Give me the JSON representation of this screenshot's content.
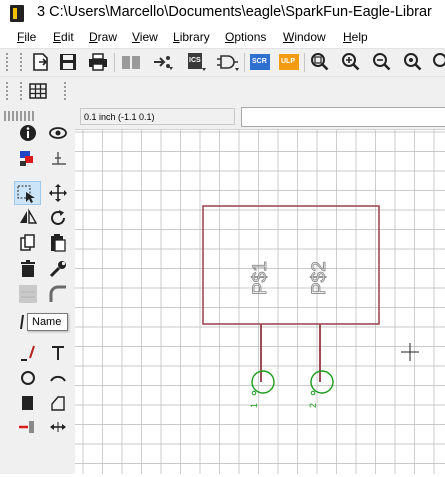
{
  "window": {
    "title": "3 C:\\Users\\Marcello\\Documents\\eagle\\SparkFun-Eagle-Librar"
  },
  "menu": [
    {
      "mnemonic": "F",
      "rest": "ile"
    },
    {
      "mnemonic": "E",
      "rest": "dit"
    },
    {
      "mnemonic": "D",
      "rest": "raw"
    },
    {
      "mnemonic": "V",
      "rest": "iew"
    },
    {
      "mnemonic": "L",
      "rest": "ibrary"
    },
    {
      "mnemonic": "O",
      "rest": "ptions"
    },
    {
      "mnemonic": "W",
      "rest": "indow"
    },
    {
      "mnemonic": "H",
      "rest": "elp"
    }
  ],
  "toolbar": {
    "icons": [
      "open-icon",
      "save-icon",
      "print-icon",
      "library-icon",
      "export-icon",
      "ics-icon",
      "gate-icon",
      "script-icon",
      "ulp-icon",
      "zoom-fit-icon",
      "zoom-in-icon",
      "zoom-out-icon",
      "zoom-last-icon"
    ],
    "script_label": "SCR",
    "ulp_label": "ULP",
    "ics_label": "ICS"
  },
  "coord_display": "0.1 inch (-1.1 0.1)",
  "command_input": "",
  "tooltip": "Name",
  "symbol": {
    "pins": [
      "P$1",
      "P$2"
    ],
    "pin_end_labels": [
      "1",
      "2"
    ]
  },
  "colors": {
    "symbol_outline": "#9c4c54",
    "pin_green": "#1c9c1c",
    "selection_bg": "#cce4f7",
    "grid": "#b9b9b9",
    "scr_icon": "#2f6fcf",
    "ulp_icon": "#f39c12"
  },
  "tools": [
    "info-icon",
    "show-icon",
    "display-layers-icon",
    "mark-icon",
    "select-icon",
    "move-icon",
    "mirror-icon",
    "rotate-icon",
    "copy-icon",
    "paste-icon",
    "delete-icon",
    "change-icon",
    "name-icon",
    "miter-icon",
    "split-icon",
    "value-icon",
    "wire-icon",
    "text-icon",
    "circle-icon",
    "arc-icon",
    "rectangle-icon",
    "polygon-icon",
    "pin-icon",
    "attribute-icon"
  ]
}
